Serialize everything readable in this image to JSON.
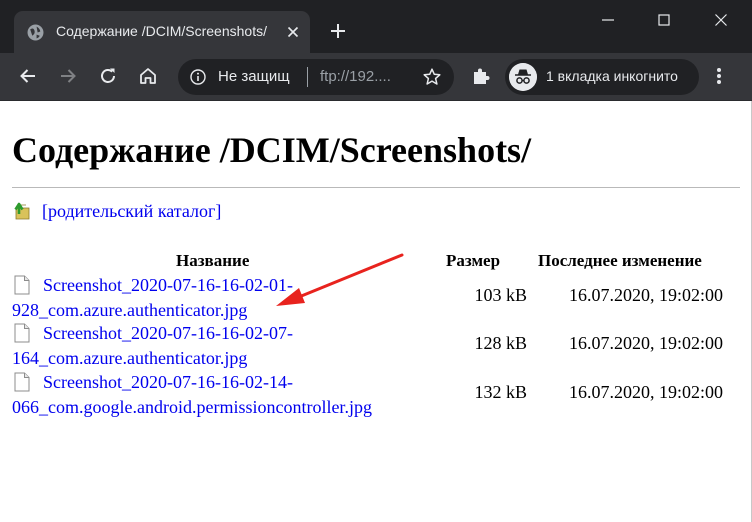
{
  "browser": {
    "tab_title": "Содержание /DCIM/Screenshots/",
    "omnibox": {
      "security_text": "Не защищ",
      "url": "ftp://192...."
    },
    "incognito_label": "1 вкладка инкогнито",
    "colors": {
      "frame": "#202124",
      "toolbar": "#35363a",
      "text": "#e8eaed"
    }
  },
  "page": {
    "heading": "Содержание /DCIM/Screenshots/",
    "parent_link": "[родительский каталог]",
    "columns": {
      "name": "Название",
      "size": "Размер",
      "modified": "Последнее изменение"
    },
    "files": [
      {
        "name_line1": "Screenshot_2020-07-16-16-02-01-",
        "name_line2": "928_com.azure.authenticator.jpg",
        "size": "103 kB",
        "modified": "16.07.2020, 19:02:00"
      },
      {
        "name_line1": "Screenshot_2020-07-16-16-02-07-",
        "name_line2": "164_com.azure.authenticator.jpg",
        "size": "128 kB",
        "modified": "16.07.2020, 19:02:00"
      },
      {
        "name_line1": "Screenshot_2020-07-16-16-02-14-",
        "name_line2": "066_com.google.android.permissioncontroller.jpg",
        "size": "132 kB",
        "modified": "16.07.2020, 19:02:00"
      }
    ],
    "link_color": "#0000ee",
    "annotation_color": "#e8231e"
  }
}
